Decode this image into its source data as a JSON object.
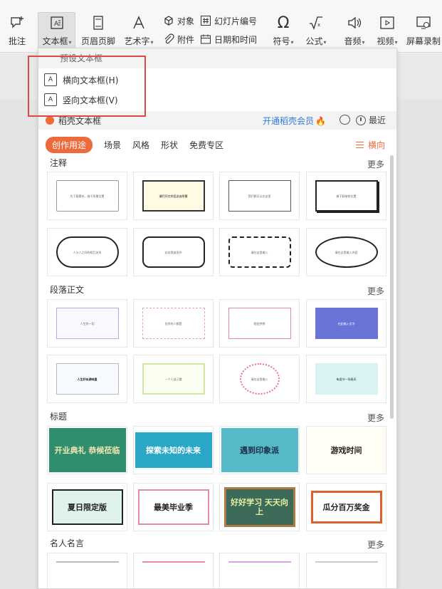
{
  "ribbon": {
    "comment_label": "批注",
    "textbox_label": "文本框",
    "header_footer_label": "页眉页脚",
    "wordart_label": "艺术字",
    "object_label": "对象",
    "slide_number_label": "幻灯片编号",
    "attachment_label": "附件",
    "datetime_label": "日期和时间",
    "symbol_label": "符号",
    "formula_label": "公式",
    "audio_label": "音频",
    "video_label": "视频",
    "screen_record_label": "屏幕录制"
  },
  "panel": {
    "preset_header": "预设文本框",
    "preset_items": [
      "横向文本框(H)",
      "竖向文本框(V)"
    ],
    "shell_title": "稻壳文本框",
    "vip_link": "开通稻壳会员",
    "recent_label": "最近",
    "tabs": [
      "创作用途",
      "场景",
      "风格",
      "形状",
      "免费专区"
    ],
    "orientation_label": "横向",
    "categories": [
      {
        "title": "注释",
        "more": "更多"
      },
      {
        "title": "段落正文",
        "more": "更多"
      },
      {
        "title": "标题",
        "more": "更多"
      },
      {
        "title": "名人名言",
        "more": "更多"
      }
    ],
    "title_cards": [
      "开业典礼 恭候莅临",
      "探索未知的未来",
      "遇到印象派",
      "游戏时间",
      "夏日限定版",
      "最美毕业季",
      "好好学习 天天向上",
      "瓜分百万奖金"
    ],
    "note_texts": [
      "先下载素材，拖于所需位置",
      "请打开文件后点击所需",
      "我们都可以在这里",
      "拿下联缩排位置",
      "人与人之间的相互关系",
      "站出我放身作",
      "请在这里输入",
      "请在这里输入内容"
    ],
    "para_texts": [
      "人生的一切",
      "优秀的人都是",
      "相信梦想",
      "在此输入文字",
      "人生好似调味盘",
      "一个人自己看",
      "请在这里输入",
      "每逢节一场春风"
    ]
  },
  "colors": {
    "accent": "#ed6a3d",
    "link": "#2f7bd6",
    "highlight_box": "#e04848"
  }
}
